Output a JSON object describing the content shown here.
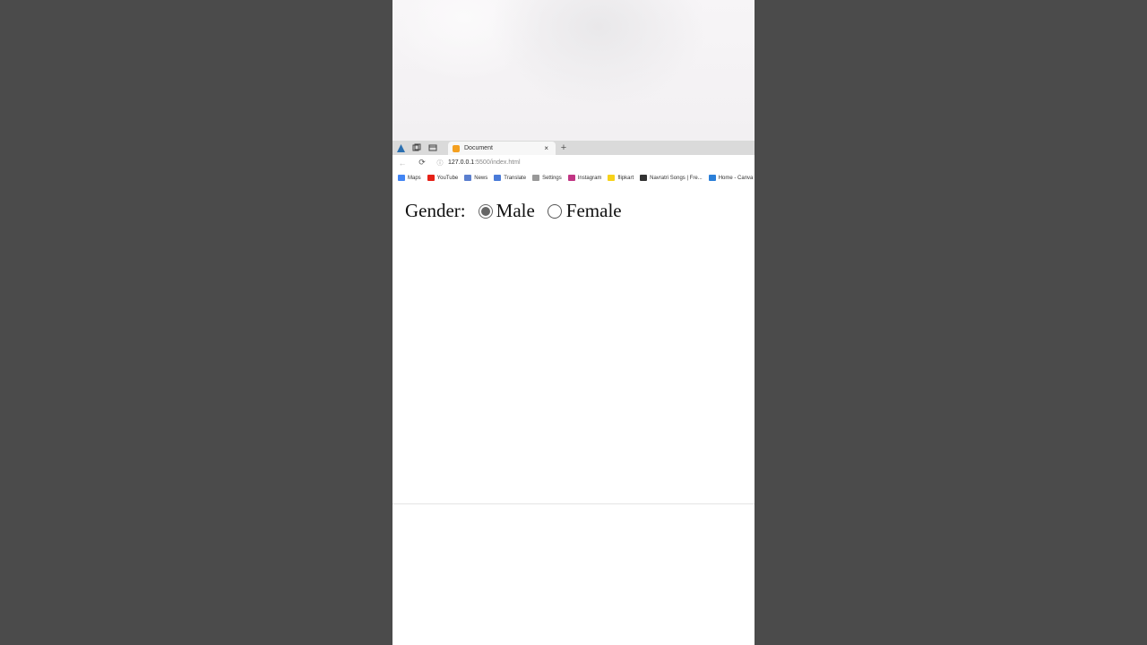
{
  "tab": {
    "title": "Document",
    "close": "×",
    "new_tab": "+"
  },
  "address": {
    "back": "←",
    "reload": "⟳",
    "info": "ⓘ",
    "url_host": "127.0.0.1",
    "url_rest": ":5500/index.html"
  },
  "bookmarks": [
    {
      "label": "Maps",
      "icon_color": "#4285f4"
    },
    {
      "label": "YouTube",
      "icon_color": "#e62117"
    },
    {
      "label": "News",
      "icon_color": "#5b7fcf"
    },
    {
      "label": "Translate",
      "icon_color": "#4a7bd8"
    },
    {
      "label": "Settings",
      "icon_color": "#999999"
    },
    {
      "label": "Instagram",
      "icon_color": "#c13584"
    },
    {
      "label": "flipkart",
      "icon_color": "#f7d21a"
    },
    {
      "label": "Navratri Songs | Fre...",
      "icon_color": "#333333"
    },
    {
      "label": "Home - Canva",
      "icon_color": "#2b7fd8"
    }
  ],
  "form": {
    "label": "Gender:",
    "options": [
      {
        "label": "Male",
        "checked": true
      },
      {
        "label": "Female",
        "checked": false
      }
    ]
  }
}
